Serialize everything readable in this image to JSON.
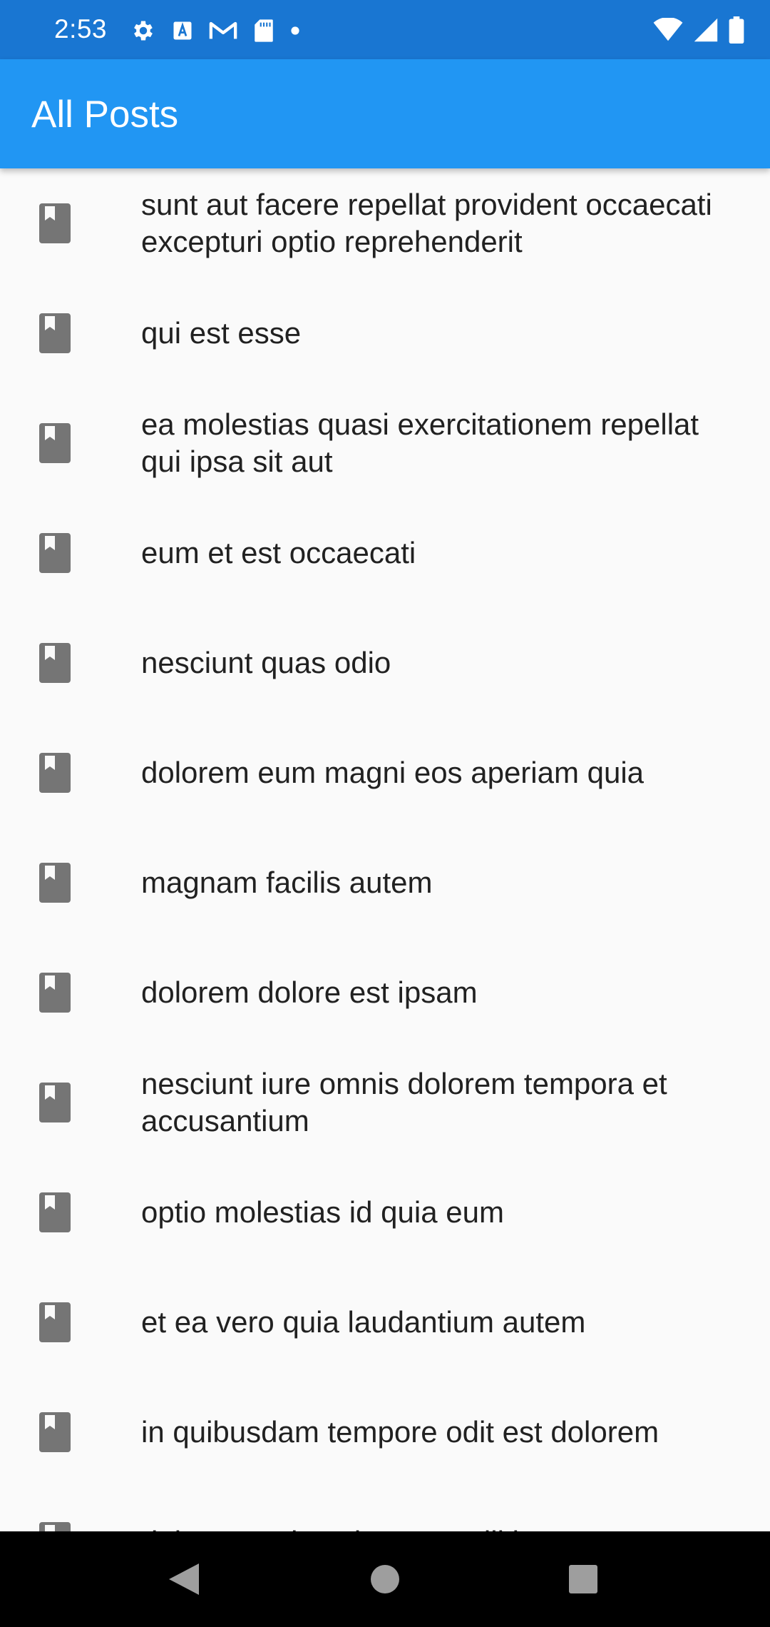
{
  "status_bar": {
    "time": "2:53",
    "left_icons": [
      "settings-icon",
      "a-icon",
      "gmail-icon",
      "sd-card-icon",
      "dot-icon"
    ],
    "right_icons": [
      "wifi-icon",
      "signal-icon",
      "battery-icon"
    ]
  },
  "app_bar": {
    "title": "All Posts",
    "color": "#2196f3"
  },
  "posts": [
    {
      "title": "sunt aut facere repellat provident occaecati excepturi optio reprehenderit"
    },
    {
      "title": "qui est esse"
    },
    {
      "title": "ea molestias quasi exercitationem repellat qui ipsa sit aut"
    },
    {
      "title": "eum et est occaecati"
    },
    {
      "title": "nesciunt quas odio"
    },
    {
      "title": "dolorem eum magni eos aperiam quia"
    },
    {
      "title": "magnam facilis autem"
    },
    {
      "title": "dolorem dolore est ipsam"
    },
    {
      "title": "nesciunt iure omnis dolorem tempora et accusantium"
    },
    {
      "title": "optio molestias id quia eum"
    },
    {
      "title": "et ea vero quia laudantium autem"
    },
    {
      "title": "in quibusdam tempore odit est dolorem"
    },
    {
      "title": "dolorum ut in voluptas mollitia et saepe"
    }
  ],
  "post_icon": "book-icon",
  "nav_bar": {
    "buttons": [
      "back-icon",
      "home-icon",
      "recents-icon"
    ]
  }
}
